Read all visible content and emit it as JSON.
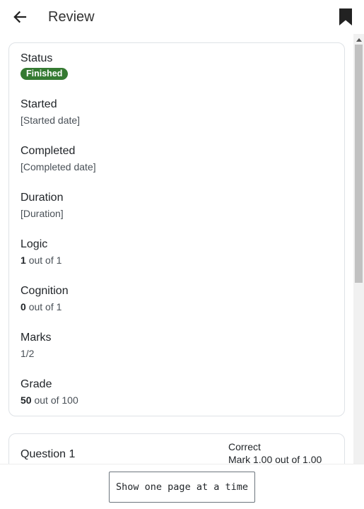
{
  "header": {
    "title": "Review",
    "back_icon": "arrow-left-icon",
    "bookmark_icon": "bookmark-icon"
  },
  "summary": {
    "status": {
      "label": "Status",
      "value": "Finished",
      "badge_color": "#357a32"
    },
    "started": {
      "label": "Started",
      "value": "[Started date]"
    },
    "completed": {
      "label": "Completed",
      "value": "[Completed date]"
    },
    "duration": {
      "label": "Duration",
      "value": "[Duration]"
    },
    "logic": {
      "label": "Logic",
      "score": "1",
      "suffix": "out of 1"
    },
    "cognition": {
      "label": "Cognition",
      "score": "0",
      "suffix": "out of 1"
    },
    "marks": {
      "label": "Marks",
      "value": "1/2"
    },
    "grade": {
      "label": "Grade",
      "score": "50",
      "suffix": "out of 100"
    }
  },
  "question": {
    "title": "Question 1",
    "state": "Correct",
    "mark": "Mark 1.00 out of 1.00"
  },
  "footer": {
    "button_label": "Show one page at a time"
  }
}
